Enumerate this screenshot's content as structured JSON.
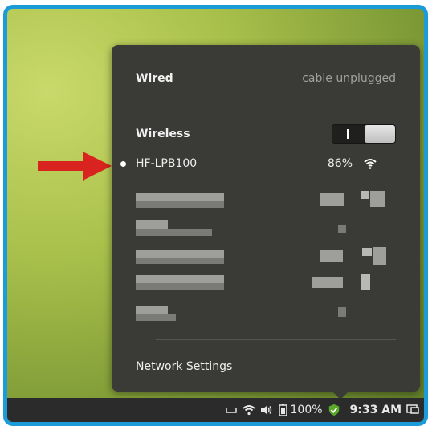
{
  "network_menu": {
    "wired": {
      "label": "Wired",
      "status": "cable unplugged"
    },
    "wireless": {
      "label": "Wireless",
      "enabled": true
    },
    "connected_network": {
      "name": "HF-LPB100",
      "signal": "86%",
      "icon": "wifi-icon"
    },
    "settings_label": "Network Settings"
  },
  "taskbar": {
    "battery": "100%",
    "clock": "9:33 AM",
    "icons": [
      "keyboard-icon",
      "wifi-icon",
      "volume-icon",
      "battery-icon",
      "shield-check-icon",
      "display-icon"
    ]
  },
  "colors": {
    "frame": "#1b9bd7",
    "arrow": "#d9231e",
    "popup": "#3a3a37",
    "shield": "#5aa82a"
  }
}
